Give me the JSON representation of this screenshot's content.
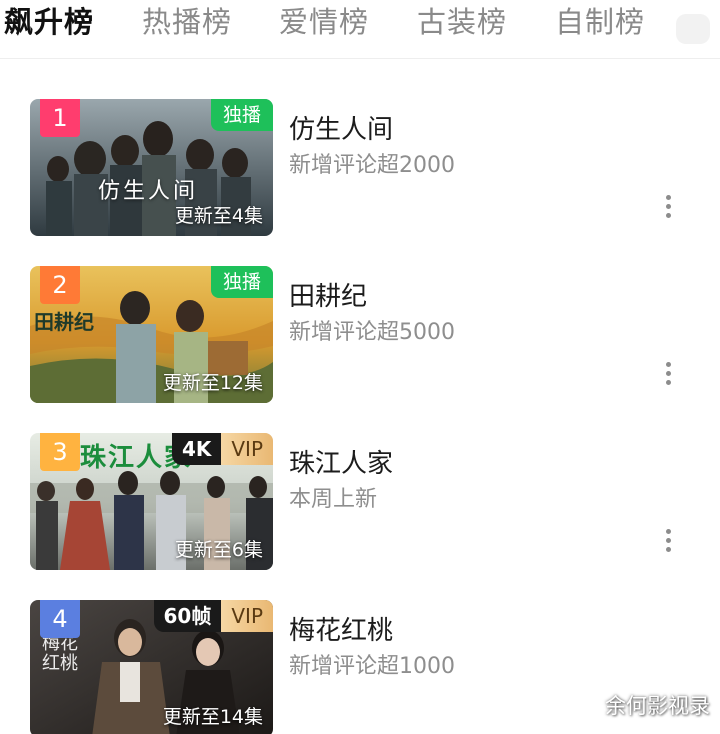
{
  "tabs": [
    {
      "label": "飙升榜",
      "active": true
    },
    {
      "label": "热播榜",
      "active": false
    },
    {
      "label": "爱情榜",
      "active": false
    },
    {
      "label": "古装榜",
      "active": false
    },
    {
      "label": "自制榜",
      "active": false
    }
  ],
  "colors": {
    "accent_green": "#1ec05a",
    "rank_1": "#ff3d6e",
    "rank_2": "#ff7a36",
    "rank_3": "#ffb340",
    "rank_4": "#5b7fe0",
    "vip_gold": "#e9b873"
  },
  "items": [
    {
      "rank": "1",
      "title": "仿生人间",
      "subtitle": "新增评论超2000",
      "badge": "独播",
      "update": "更新至4集",
      "poster_text": "仿生人间",
      "more_icon": "more-vertical-icon"
    },
    {
      "rank": "2",
      "title": "田耕纪",
      "subtitle": "新增评论超5000",
      "badge": "独播",
      "update": "更新至12集",
      "poster_text": "田耕纪",
      "more_icon": "more-vertical-icon"
    },
    {
      "rank": "3",
      "title": "珠江人家",
      "subtitle": "本周上新",
      "badge_quality": "4K",
      "badge_vip": "VIP",
      "update": "更新至6集",
      "poster_text": "珠江人家",
      "more_icon": "more-vertical-icon"
    },
    {
      "rank": "4",
      "title": "梅花红桃",
      "subtitle": "新增评论超1000",
      "badge_quality": "60帧",
      "badge_vip": "VIP",
      "update": "更新至14集",
      "poster_text": "梅花红桃",
      "more_icon": "more-vertical-icon"
    }
  ],
  "watermark": "余何影视录"
}
